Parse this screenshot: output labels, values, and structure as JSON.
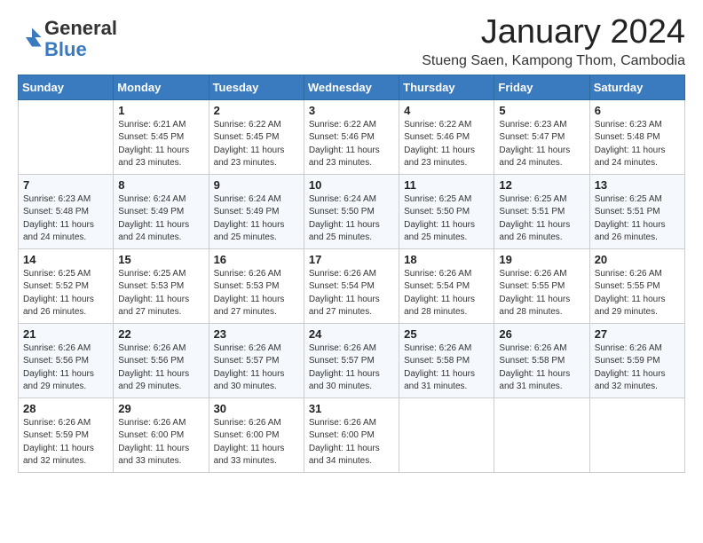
{
  "logo": {
    "general": "General",
    "blue": "Blue"
  },
  "title": "January 2024",
  "location": "Stueng Saen, Kampong Thom, Cambodia",
  "days_of_week": [
    "Sunday",
    "Monday",
    "Tuesday",
    "Wednesday",
    "Thursday",
    "Friday",
    "Saturday"
  ],
  "weeks": [
    [
      {
        "day": "",
        "sunrise": "",
        "sunset": "",
        "daylight": ""
      },
      {
        "day": "1",
        "sunrise": "Sunrise: 6:21 AM",
        "sunset": "Sunset: 5:45 PM",
        "daylight": "Daylight: 11 hours and 23 minutes."
      },
      {
        "day": "2",
        "sunrise": "Sunrise: 6:22 AM",
        "sunset": "Sunset: 5:45 PM",
        "daylight": "Daylight: 11 hours and 23 minutes."
      },
      {
        "day": "3",
        "sunrise": "Sunrise: 6:22 AM",
        "sunset": "Sunset: 5:46 PM",
        "daylight": "Daylight: 11 hours and 23 minutes."
      },
      {
        "day": "4",
        "sunrise": "Sunrise: 6:22 AM",
        "sunset": "Sunset: 5:46 PM",
        "daylight": "Daylight: 11 hours and 23 minutes."
      },
      {
        "day": "5",
        "sunrise": "Sunrise: 6:23 AM",
        "sunset": "Sunset: 5:47 PM",
        "daylight": "Daylight: 11 hours and 24 minutes."
      },
      {
        "day": "6",
        "sunrise": "Sunrise: 6:23 AM",
        "sunset": "Sunset: 5:48 PM",
        "daylight": "Daylight: 11 hours and 24 minutes."
      }
    ],
    [
      {
        "day": "7",
        "sunrise": "Sunrise: 6:23 AM",
        "sunset": "Sunset: 5:48 PM",
        "daylight": "Daylight: 11 hours and 24 minutes."
      },
      {
        "day": "8",
        "sunrise": "Sunrise: 6:24 AM",
        "sunset": "Sunset: 5:49 PM",
        "daylight": "Daylight: 11 hours and 24 minutes."
      },
      {
        "day": "9",
        "sunrise": "Sunrise: 6:24 AM",
        "sunset": "Sunset: 5:49 PM",
        "daylight": "Daylight: 11 hours and 25 minutes."
      },
      {
        "day": "10",
        "sunrise": "Sunrise: 6:24 AM",
        "sunset": "Sunset: 5:50 PM",
        "daylight": "Daylight: 11 hours and 25 minutes."
      },
      {
        "day": "11",
        "sunrise": "Sunrise: 6:25 AM",
        "sunset": "Sunset: 5:50 PM",
        "daylight": "Daylight: 11 hours and 25 minutes."
      },
      {
        "day": "12",
        "sunrise": "Sunrise: 6:25 AM",
        "sunset": "Sunset: 5:51 PM",
        "daylight": "Daylight: 11 hours and 26 minutes."
      },
      {
        "day": "13",
        "sunrise": "Sunrise: 6:25 AM",
        "sunset": "Sunset: 5:51 PM",
        "daylight": "Daylight: 11 hours and 26 minutes."
      }
    ],
    [
      {
        "day": "14",
        "sunrise": "Sunrise: 6:25 AM",
        "sunset": "Sunset: 5:52 PM",
        "daylight": "Daylight: 11 hours and 26 minutes."
      },
      {
        "day": "15",
        "sunrise": "Sunrise: 6:25 AM",
        "sunset": "Sunset: 5:53 PM",
        "daylight": "Daylight: 11 hours and 27 minutes."
      },
      {
        "day": "16",
        "sunrise": "Sunrise: 6:26 AM",
        "sunset": "Sunset: 5:53 PM",
        "daylight": "Daylight: 11 hours and 27 minutes."
      },
      {
        "day": "17",
        "sunrise": "Sunrise: 6:26 AM",
        "sunset": "Sunset: 5:54 PM",
        "daylight": "Daylight: 11 hours and 27 minutes."
      },
      {
        "day": "18",
        "sunrise": "Sunrise: 6:26 AM",
        "sunset": "Sunset: 5:54 PM",
        "daylight": "Daylight: 11 hours and 28 minutes."
      },
      {
        "day": "19",
        "sunrise": "Sunrise: 6:26 AM",
        "sunset": "Sunset: 5:55 PM",
        "daylight": "Daylight: 11 hours and 28 minutes."
      },
      {
        "day": "20",
        "sunrise": "Sunrise: 6:26 AM",
        "sunset": "Sunset: 5:55 PM",
        "daylight": "Daylight: 11 hours and 29 minutes."
      }
    ],
    [
      {
        "day": "21",
        "sunrise": "Sunrise: 6:26 AM",
        "sunset": "Sunset: 5:56 PM",
        "daylight": "Daylight: 11 hours and 29 minutes."
      },
      {
        "day": "22",
        "sunrise": "Sunrise: 6:26 AM",
        "sunset": "Sunset: 5:56 PM",
        "daylight": "Daylight: 11 hours and 29 minutes."
      },
      {
        "day": "23",
        "sunrise": "Sunrise: 6:26 AM",
        "sunset": "Sunset: 5:57 PM",
        "daylight": "Daylight: 11 hours and 30 minutes."
      },
      {
        "day": "24",
        "sunrise": "Sunrise: 6:26 AM",
        "sunset": "Sunset: 5:57 PM",
        "daylight": "Daylight: 11 hours and 30 minutes."
      },
      {
        "day": "25",
        "sunrise": "Sunrise: 6:26 AM",
        "sunset": "Sunset: 5:58 PM",
        "daylight": "Daylight: 11 hours and 31 minutes."
      },
      {
        "day": "26",
        "sunrise": "Sunrise: 6:26 AM",
        "sunset": "Sunset: 5:58 PM",
        "daylight": "Daylight: 11 hours and 31 minutes."
      },
      {
        "day": "27",
        "sunrise": "Sunrise: 6:26 AM",
        "sunset": "Sunset: 5:59 PM",
        "daylight": "Daylight: 11 hours and 32 minutes."
      }
    ],
    [
      {
        "day": "28",
        "sunrise": "Sunrise: 6:26 AM",
        "sunset": "Sunset: 5:59 PM",
        "daylight": "Daylight: 11 hours and 32 minutes."
      },
      {
        "day": "29",
        "sunrise": "Sunrise: 6:26 AM",
        "sunset": "Sunset: 6:00 PM",
        "daylight": "Daylight: 11 hours and 33 minutes."
      },
      {
        "day": "30",
        "sunrise": "Sunrise: 6:26 AM",
        "sunset": "Sunset: 6:00 PM",
        "daylight": "Daylight: 11 hours and 33 minutes."
      },
      {
        "day": "31",
        "sunrise": "Sunrise: 6:26 AM",
        "sunset": "Sunset: 6:00 PM",
        "daylight": "Daylight: 11 hours and 34 minutes."
      },
      {
        "day": "",
        "sunrise": "",
        "sunset": "",
        "daylight": ""
      },
      {
        "day": "",
        "sunrise": "",
        "sunset": "",
        "daylight": ""
      },
      {
        "day": "",
        "sunrise": "",
        "sunset": "",
        "daylight": ""
      }
    ]
  ]
}
